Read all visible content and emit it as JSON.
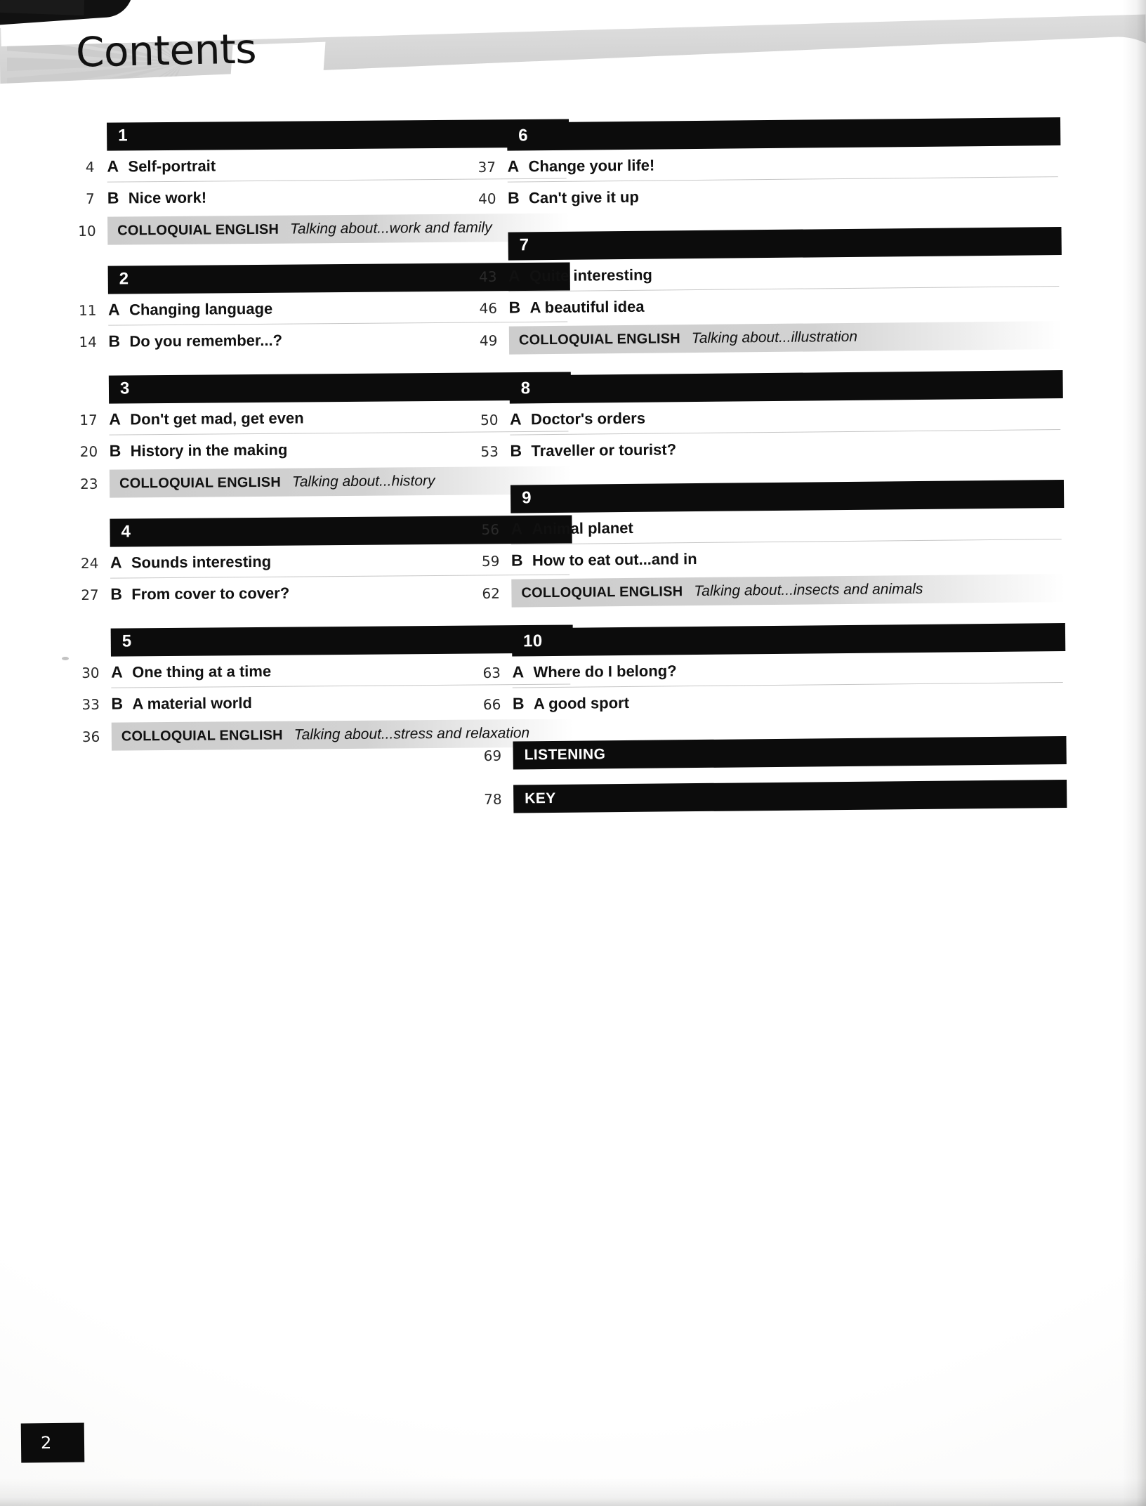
{
  "header": {
    "title": "Contents"
  },
  "page_number": "2",
  "labels": {
    "colloquial_english": "COLLOQUIAL ENGLISH"
  },
  "columns": {
    "left": [
      {
        "type": "unit",
        "number": "1",
        "rows": [
          {
            "type": "lesson",
            "page": "4",
            "letter": "A",
            "title": "Self-portrait"
          },
          {
            "type": "lesson",
            "page": "7",
            "letter": "B",
            "title": "Nice work!"
          },
          {
            "type": "colloquial",
            "page": "10",
            "label": "COLLOQUIAL ENGLISH",
            "subtitle": "Talking about...work and family"
          }
        ]
      },
      {
        "type": "unit",
        "number": "2",
        "rows": [
          {
            "type": "lesson",
            "page": "11",
            "letter": "A",
            "title": "Changing language"
          },
          {
            "type": "lesson",
            "page": "14",
            "letter": "B",
            "title": "Do you remember...?"
          }
        ]
      },
      {
        "type": "unit",
        "number": "3",
        "rows": [
          {
            "type": "lesson",
            "page": "17",
            "letter": "A",
            "title": "Don't get mad, get even"
          },
          {
            "type": "lesson",
            "page": "20",
            "letter": "B",
            "title": "History in the making"
          },
          {
            "type": "colloquial",
            "page": "23",
            "label": "COLLOQUIAL ENGLISH",
            "subtitle": "Talking about...history"
          }
        ]
      },
      {
        "type": "unit",
        "number": "4",
        "rows": [
          {
            "type": "lesson",
            "page": "24",
            "letter": "A",
            "title": "Sounds interesting"
          },
          {
            "type": "lesson",
            "page": "27",
            "letter": "B",
            "title": "From cover to cover?"
          }
        ]
      },
      {
        "type": "unit",
        "number": "5",
        "rows": [
          {
            "type": "lesson",
            "page": "30",
            "letter": "A",
            "title": "One thing at a time"
          },
          {
            "type": "lesson",
            "page": "33",
            "letter": "B",
            "title": "A material world"
          },
          {
            "type": "colloquial",
            "page": "36",
            "label": "COLLOQUIAL ENGLISH",
            "subtitle": "Talking about...stress and relaxation"
          }
        ]
      }
    ],
    "right": [
      {
        "type": "unit",
        "number": "6",
        "rows": [
          {
            "type": "lesson",
            "page": "37",
            "letter": "A",
            "title": "Change your life!"
          },
          {
            "type": "lesson",
            "page": "40",
            "letter": "B",
            "title": "Can't give it up"
          }
        ]
      },
      {
        "type": "unit",
        "number": "7",
        "rows": [
          {
            "type": "lesson",
            "page": "43",
            "letter": "A",
            "title": "Quite interesting"
          },
          {
            "type": "lesson",
            "page": "46",
            "letter": "B",
            "title": "A beautiful idea"
          },
          {
            "type": "colloquial",
            "page": "49",
            "label": "COLLOQUIAL ENGLISH",
            "subtitle": "Talking about...illustration"
          }
        ]
      },
      {
        "type": "unit",
        "number": "8",
        "rows": [
          {
            "type": "lesson",
            "page": "50",
            "letter": "A",
            "title": "Doctor's orders"
          },
          {
            "type": "lesson",
            "page": "53",
            "letter": "B",
            "title": "Traveller or tourist?"
          }
        ]
      },
      {
        "type": "unit",
        "number": "9",
        "rows": [
          {
            "type": "lesson",
            "page": "56",
            "letter": "A",
            "title": "Animal planet"
          },
          {
            "type": "lesson",
            "page": "59",
            "letter": "B",
            "title": "How to eat out...and in"
          },
          {
            "type": "colloquial",
            "page": "62",
            "label": "COLLOQUIAL ENGLISH",
            "subtitle": "Talking about...insects and animals"
          }
        ]
      },
      {
        "type": "unit",
        "number": "10",
        "rows": [
          {
            "type": "lesson",
            "page": "63",
            "letter": "A",
            "title": "Where do I belong?"
          },
          {
            "type": "lesson",
            "page": "66",
            "letter": "B",
            "title": "A good sport"
          }
        ]
      },
      {
        "type": "section",
        "rows": [
          {
            "type": "section",
            "page": "69",
            "title": "LISTENING"
          }
        ]
      },
      {
        "type": "section",
        "rows": [
          {
            "type": "section",
            "page": "78",
            "title": "KEY"
          }
        ]
      }
    ]
  },
  "colors": {
    "bar_black": "#0c0c0c",
    "colloquial_gray": "#cfcfcf",
    "rule_gray": "#c6c6c6",
    "text": "#111111"
  }
}
